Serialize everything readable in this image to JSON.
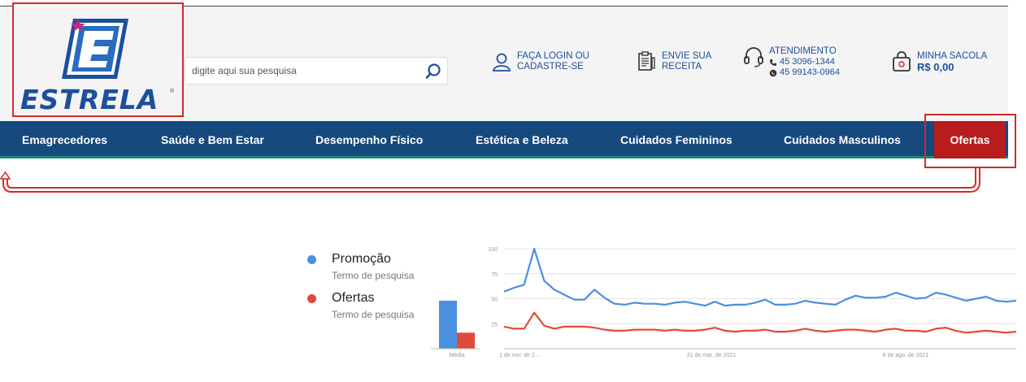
{
  "header": {
    "logo_text": "ESTRELA",
    "logo_reg": "®",
    "search_placeholder": "digite aqui sua pesquisa",
    "login": {
      "line1": "FAÇA LOGIN OU",
      "line2": "CADASTRE-SE",
      "icon": "user-icon"
    },
    "recipe": {
      "line1": "ENVIE SUA",
      "line2": "RECEITA",
      "icon": "prescription-icon"
    },
    "support": {
      "line1": "ATENDIMENTO",
      "phone": "45 3096-1344",
      "whatsapp": "45 99143-0964",
      "icon": "headset-icon"
    },
    "bag": {
      "line1": "MINHA SACOLA",
      "line2": "R$ 0,00",
      "icon": "shopping-bag-icon"
    }
  },
  "nav": {
    "items": [
      "Emagrecedores",
      "Saúde e Bem Estar",
      "Desempenho Físico",
      "Estética e Beleza",
      "Cuidados Femininos",
      "Cuidados Masculinos"
    ],
    "offers": "Ofertas"
  },
  "colors": {
    "brand_blue": "#16497e",
    "offers_red": "#b81c1c",
    "highlight_red": "#d42a2a",
    "series_blue": "#4a8fe0",
    "series_red": "#e04a3a"
  },
  "trends": {
    "legend": [
      {
        "name": "Promoção",
        "sub": "Termo de pesquisa",
        "color": "#4a8fe0"
      },
      {
        "name": "Ofertas",
        "sub": "Termo de pesquisa",
        "color": "#e04a3a"
      }
    ]
  },
  "chart_data": {
    "type": "line",
    "title": "",
    "xlabel": "",
    "ylabel": "",
    "ylim": [
      0,
      100
    ],
    "yticks": [
      "100",
      "75",
      "50",
      "25"
    ],
    "xticks": [
      "1 de nov. de 2...",
      "21 de mar. de 2021",
      "8 de ago. de 2021"
    ],
    "avg_label": "Média",
    "averages": [
      48,
      16
    ],
    "series": [
      {
        "name": "Promoção",
        "color": "#4a8fe0",
        "values": [
          57,
          61,
          64,
          100,
          68,
          59,
          54,
          49,
          49,
          59,
          51,
          45,
          44,
          46,
          45,
          45,
          44,
          46,
          47,
          45,
          43,
          47,
          43,
          44,
          44,
          46,
          49,
          44,
          44,
          45,
          48,
          46,
          45,
          44,
          49,
          53,
          51,
          51,
          52,
          56,
          53,
          50,
          51,
          56,
          54,
          51,
          48,
          50,
          52,
          48,
          47,
          48
        ]
      },
      {
        "name": "Ofertas",
        "color": "#e04a3a",
        "values": [
          22,
          20,
          20,
          36,
          23,
          20,
          22,
          22,
          22,
          21,
          19,
          18,
          18,
          19,
          19,
          19,
          18,
          19,
          18,
          18,
          19,
          21,
          18,
          17,
          18,
          18,
          19,
          17,
          17,
          18,
          20,
          18,
          17,
          18,
          19,
          19,
          18,
          17,
          19,
          20,
          18,
          18,
          17,
          20,
          21,
          18,
          16,
          17,
          18,
          17,
          16,
          17
        ]
      }
    ]
  }
}
